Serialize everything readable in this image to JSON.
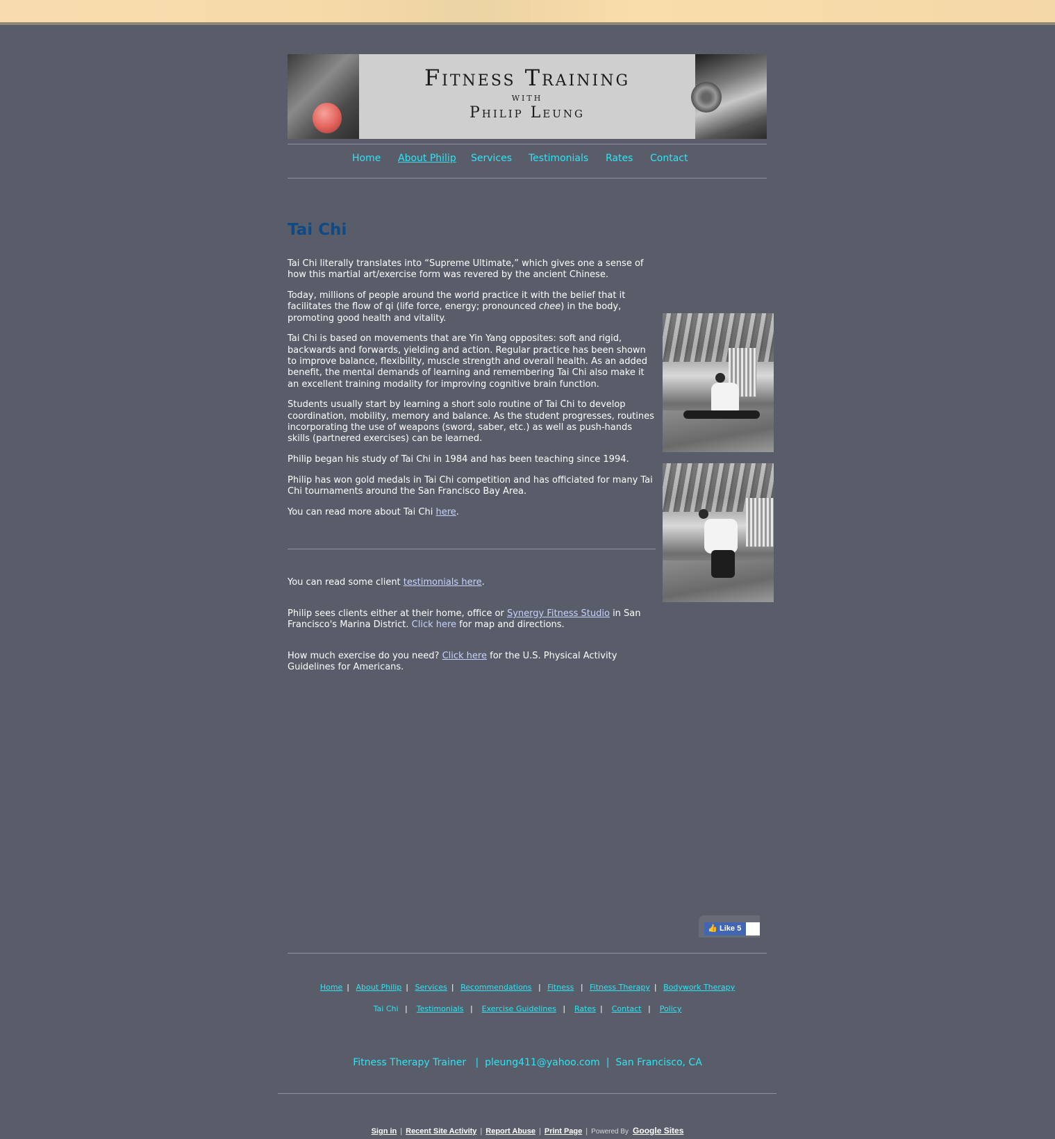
{
  "header": {
    "title_line1": "Fitness Training",
    "title_line2": "with",
    "title_line3": "Philip Leung"
  },
  "nav": {
    "items": [
      {
        "label": "Home"
      },
      {
        "label": "About Philip",
        "active": true
      },
      {
        "label": "Services"
      },
      {
        "label": "Testimonials"
      },
      {
        "label": "Rates"
      },
      {
        "label": "Contact"
      }
    ]
  },
  "page": {
    "title": "Tai Chi",
    "p1": "Tai Chi literally translates into “Supreme Ultimate,” which gives one a sense of how this martial art/exercise form was revered by the ancient Chinese.",
    "p2_before": "Today, millions of people around the world practice it with the belief that it facilitates the flow of qi (life force, energy; pronounced ",
    "p2_italic": "chee",
    "p2_after": ") in the body, promoting good health and vitality.",
    "p3": "Tai Chi is based on movements that are Yin Yang opposites: soft and rigid, backwards and forwards, yielding and action.  Regular practice has been shown to improve balance, flexibility, muscle strength and overall health.  As an added benefit, the mental demands of learning and remembering Tai Chi also make it an excellent training modality for improving cognitive brain function.",
    "p4": "Students usually start by learning a short solo routine of Tai Chi to develop coordination, mobility, memory and balance.  As the student progresses, routines incorporating the use of weapons (sword, saber, etc.) as well as push-hands skills (partnered exercises) can be learned.",
    "p5": "Philip began his study of Tai Chi in 1984 and has been teaching since 1994.",
    "p6": "Philip has won gold medals in Tai Chi competition and has officiated for many Tai Chi tournaments around the San Francisco Bay Area.",
    "p7_before": "You can read more about Tai Chi ",
    "p7_link": "here",
    "p7_after": "."
  },
  "lower": {
    "testimonials_before": "You can read some client ",
    "testimonials_link": "testimonials here",
    "testimonials_after": ".",
    "location_before": "Philip sees clients either at their home, office or ",
    "location_link": "Synergy Fitness Studio",
    "location_middle": " in San Francisco's Marina District. ",
    "location_link2": "Click here",
    "location_after": " for map and directions.",
    "exercise_before": "How much exercise do you need?  ",
    "exercise_link": "Click here",
    "exercise_after": " for the U.S. Physical Activity Guidelines for Americans."
  },
  "facebook": {
    "like_label": "Like 5"
  },
  "footer_nav": {
    "row1": [
      "Home",
      "About Philip",
      "Services",
      "Recommendations",
      "Fitness",
      "Fitness Therapy",
      "Bodywork Therapy"
    ],
    "row2_current": "Tai Chi",
    "row2": [
      "Testimonials",
      "Exercise Guidelines",
      "Rates",
      "Contact",
      "Policy"
    ]
  },
  "contact_line": {
    "role": "Fitness Therapy Trainer",
    "email": "pleung411@yahoo.com",
    "location": "San Francisco, CA",
    "separator": "|"
  },
  "sites_bar": {
    "sign_in": "Sign in",
    "recent": "Recent Site Activity",
    "report": "Report Abuse",
    "print": "Print Page",
    "powered": "Powered By",
    "google": "Google Sites",
    "separator": "|"
  },
  "colors": {
    "background": "#585d69",
    "nav_link": "#2fe4f4",
    "title": "#0d4a86",
    "body_link": "#c9d2ff"
  }
}
